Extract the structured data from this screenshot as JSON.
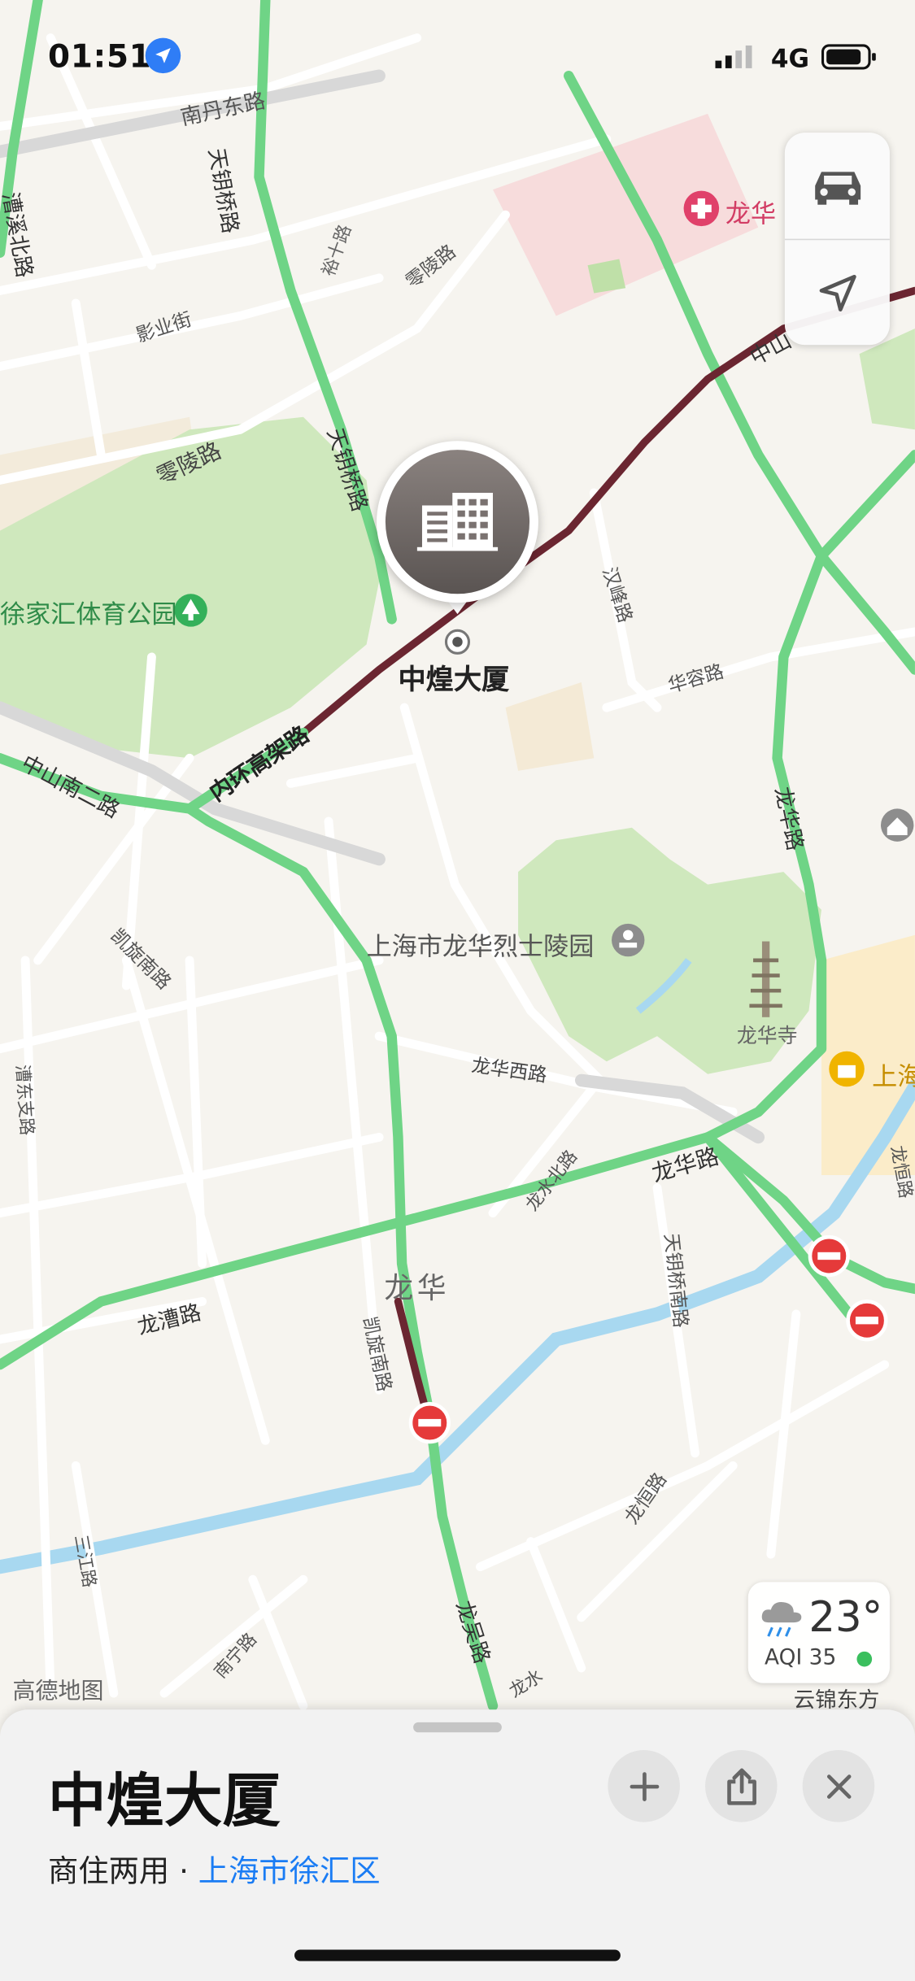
{
  "status_bar": {
    "time": "01:51",
    "network": "4G"
  },
  "map_labels": {
    "nandan_road": "南丹东路",
    "tianyao_bridge_road_north": "天钥桥路",
    "caoxi_road": "漕溪北路",
    "longhua_hospital": "龙华",
    "shiliu_road": "裕十路",
    "lingling_road_top": "零陵路",
    "yingye_street": "影业街",
    "lingling_road": "零陵路",
    "tianyao_bridge_road_mid": "天钥桥路",
    "zhongshan_road_ne": "中山",
    "xujiahui_park": "徐家汇体育公园",
    "hanfeng_road": "汉峰路",
    "huarong_road": "华容路",
    "zhongshan_south2_road": "中山南二路",
    "inner_ring": "内环高架路",
    "selected_building": "中煌大厦",
    "longhua_road_east": "龙华路",
    "kaixuan_south_road_top": "凯旋南路",
    "martyrs_cemetery": "上海市龙华烈士陵园",
    "longhua_temple": "龙华寺",
    "shanghai_edge": "上海",
    "caodong_branch_road": "漕东支路",
    "longhua_west_road": "龙华西路",
    "longshui_north_road": "龙水北路",
    "longhua_road": "龙华路",
    "longheng_road": "龙恒路",
    "tianyao_bridge_south_road": "天钥桥南路",
    "longhua_district": "龙华",
    "longcao_road": "龙漕路",
    "kaixuan_south_road": "凯旋南路",
    "longheng_road_lower": "龙恒路",
    "sanjiang_road": "三江路",
    "longwu_road": "龙吴路",
    "longshui_road": "龙水",
    "nanning_road": "南宁路",
    "amap_watermark": "高德地图",
    "yunjin_dongfang": "云锦东方"
  },
  "weather": {
    "temperature": "23°",
    "aqi": "AQI 35"
  },
  "place_card": {
    "name": "中煌大厦",
    "category": "商住两用",
    "separator": " · ",
    "district": "上海市徐汇区"
  },
  "icons": {
    "location_arrow": "location-arrow-icon",
    "car": "car-icon",
    "navigate": "navigation-arrow-icon",
    "building": "building-icon",
    "park": "tree-icon",
    "memorial": "memorial-icon",
    "hospital": "hospital-icon",
    "shopping": "shopping-bag-icon",
    "weather": "rain-cloud-icon",
    "road_closed": "road-closed-icon",
    "add": "plus-icon",
    "share": "share-icon",
    "close": "close-icon"
  },
  "colors": {
    "traffic_green": "#6fd486",
    "traffic_congested": "#6b2631",
    "water": "#a8d8f0",
    "park": "#cfe8bd",
    "link_blue": "#1a7cf4",
    "road_closed_red": "#e53a3a"
  }
}
